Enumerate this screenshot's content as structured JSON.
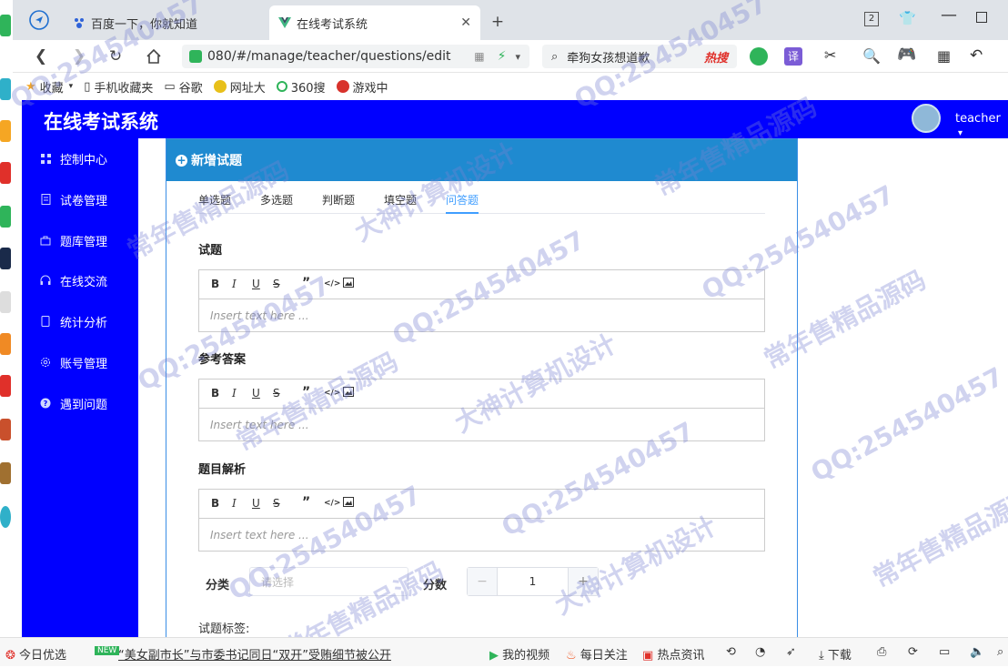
{
  "browser": {
    "tabs": [
      {
        "label": "百度一下，你就知道",
        "active": false
      },
      {
        "label": "在线考试系统",
        "active": true
      }
    ],
    "new_tab_icon": "plus-icon",
    "tab_count": "2",
    "url": "080/#/manage/teacher/questions/edit",
    "search_text": "牵狗女孩想道歉",
    "hot_search": "热搜",
    "bookmarks": [
      "收藏",
      "手机收藏夹",
      "谷歌",
      "网址大",
      "360搜",
      "游戏中"
    ],
    "translate_label": "译"
  },
  "app": {
    "title": "在线考试系统",
    "username": "teacher",
    "accent_color": "#0000ff",
    "card_color": "#1f8ad0"
  },
  "sidebar": {
    "items": [
      {
        "label": "控制中心",
        "icon": "grid-icon"
      },
      {
        "label": "试卷管理",
        "icon": "document-icon"
      },
      {
        "label": "题库管理",
        "icon": "bag-icon"
      },
      {
        "label": "在线交流",
        "icon": "headset-icon"
      },
      {
        "label": "统计分析",
        "icon": "phone-icon"
      },
      {
        "label": "账号管理",
        "icon": "gear-icon"
      },
      {
        "label": "遇到问题",
        "icon": "question-icon"
      }
    ]
  },
  "card": {
    "title": "新增试题",
    "type_tabs": [
      "单选题",
      "多选题",
      "判断题",
      "填空题",
      "问答题"
    ],
    "active_tab": "问答题",
    "sections": [
      {
        "title": "试题",
        "placeholder": "Insert text here ..."
      },
      {
        "title": "参考答案",
        "placeholder": "Insert text here ..."
      },
      {
        "title": "题目解析",
        "placeholder": "Insert text here ..."
      }
    ],
    "toolbar": [
      "B",
      "I",
      "U",
      "S",
      "”",
      "</>",
      "image-icon"
    ],
    "category_label": "分类",
    "category_placeholder": "请选择",
    "score_label": "分数",
    "score_value": "1",
    "tags_label": "试题标签:"
  },
  "statusbar": {
    "left": "今日优选",
    "news_badge": "NEW",
    "news": "“美女副市长”与市委书记同日“双开”受贿细节被公开",
    "items": [
      "我的视频",
      "每日关注",
      "热点资讯",
      "下载"
    ]
  },
  "watermarks": [
    "QQ:254540457",
    "常年售精品源码",
    "大神计算机设计"
  ]
}
